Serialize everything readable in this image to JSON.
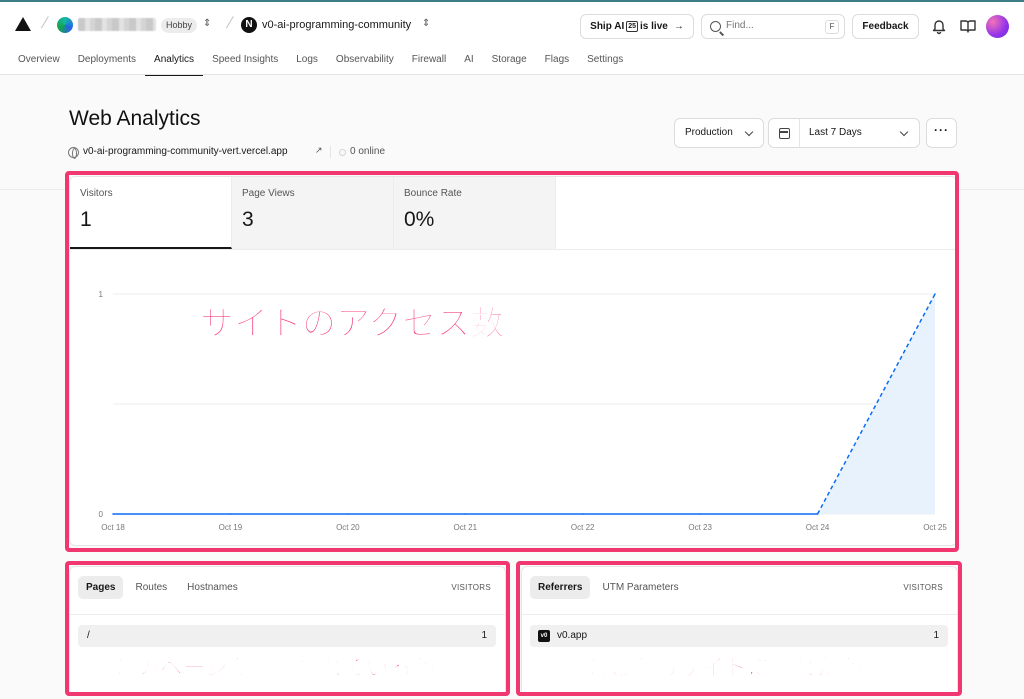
{
  "topbar": {
    "team_plan": "Hobby",
    "project_initial": "N",
    "project_name": "v0-ai-programming-community",
    "ship_prefix": "Ship AI",
    "ship_badge": "25",
    "ship_suffix": "is live",
    "ship_arrow": "→",
    "search_placeholder": "Find...",
    "search_shortcut": "F",
    "feedback_label": "Feedback"
  },
  "nav": {
    "tabs": [
      {
        "label": "Overview"
      },
      {
        "label": "Deployments"
      },
      {
        "label": "Analytics"
      },
      {
        "label": "Speed Insights"
      },
      {
        "label": "Logs"
      },
      {
        "label": "Observability"
      },
      {
        "label": "Firewall"
      },
      {
        "label": "AI"
      },
      {
        "label": "Storage"
      },
      {
        "label": "Flags"
      },
      {
        "label": "Settings"
      }
    ],
    "active": "Analytics"
  },
  "header": {
    "title": "Web Analytics",
    "url": "v0-ai-programming-community-vert.vercel.app",
    "online": "0 online",
    "environment": "Production",
    "date_range": "Last 7 Days",
    "more_label": "···"
  },
  "metrics": [
    {
      "label": "Visitors",
      "value": "1"
    },
    {
      "label": "Page Views",
      "value": "3"
    },
    {
      "label": "Bounce Rate",
      "value": "0%"
    }
  ],
  "chart_data": {
    "type": "area",
    "series_color": "#0a6cf5",
    "fill_color": "#e8f2fd",
    "x": [
      "Oct 18",
      "Oct 19",
      "Oct 20",
      "Oct 21",
      "Oct 22",
      "Oct 23",
      "Oct 24",
      "Oct 25"
    ],
    "series": [
      {
        "values": [
          0,
          0,
          0,
          0,
          0,
          0,
          0,
          1
        ]
      }
    ],
    "y_ticks": [
      "0",
      "1"
    ],
    "ylim": [
      0,
      1
    ],
    "last_segment_style": "dashed",
    "grid": true
  },
  "pages_card": {
    "tabs": [
      "Pages",
      "Routes",
      "Hostnames"
    ],
    "column_header": "VISITORS",
    "rows": [
      {
        "label": "/",
        "value": "1"
      }
    ]
  },
  "referrers_card": {
    "tabs": [
      "Referrers",
      "UTM Parameters"
    ],
    "column_header": "VISITORS",
    "rows": [
      {
        "icon": "v0",
        "label": "v0.app",
        "value": "1"
      }
    ]
  },
  "annotations": {
    "chart": "サイトのアクセス数",
    "pages": "どのページが閲覧されているか",
    "referrers": "どこからサイトに訪れたか",
    "color": "#f0376f"
  }
}
